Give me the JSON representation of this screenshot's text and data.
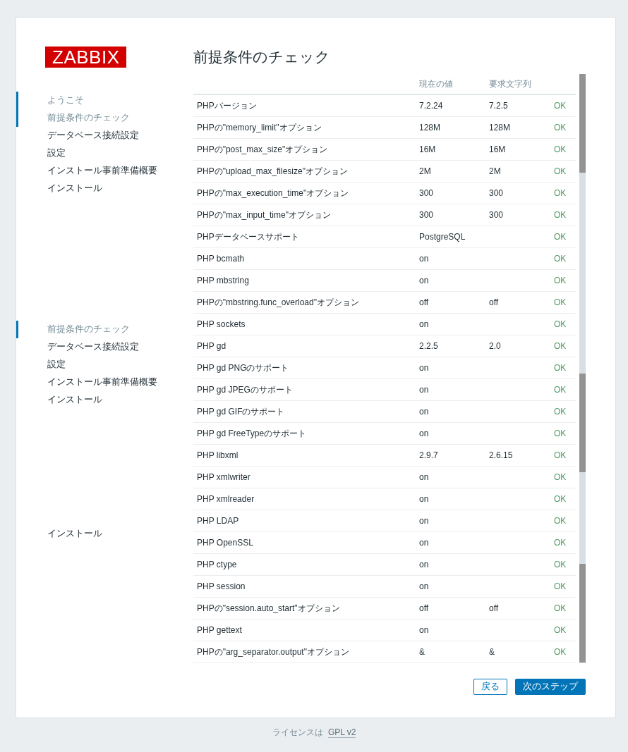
{
  "sidebar": {
    "logo": "ZABBIX",
    "groups": [
      {
        "items": [
          {
            "label": "ようこそ",
            "completed": true
          },
          {
            "label": "前提条件のチェック",
            "completed": true
          },
          {
            "label": "データベース接続設定",
            "completed": false
          },
          {
            "label": "設定",
            "completed": false
          },
          {
            "label": "インストール事前準備概要",
            "completed": false
          },
          {
            "label": "インストール",
            "completed": false
          }
        ]
      },
      {
        "items": [
          {
            "label": "前提条件のチェック",
            "completed": true
          },
          {
            "label": "データベース接続設定",
            "completed": false
          },
          {
            "label": "設定",
            "completed": false
          },
          {
            "label": "インストール事前準備概要",
            "completed": false
          },
          {
            "label": "インストール",
            "completed": false
          }
        ]
      },
      {
        "items": [
          {
            "label": "インストール",
            "completed": false
          }
        ]
      }
    ]
  },
  "title": "前提条件のチェック",
  "table": {
    "columns": [
      "現在の値",
      "要求文字列"
    ],
    "rows": [
      {
        "name": "PHPバージョン",
        "current": "7.2.24",
        "required": "7.2.5",
        "result": "OK",
        "passed": true
      },
      {
        "name": "PHPの\"memory_limit\"オプション",
        "current": "128M",
        "required": "128M",
        "result": "OK",
        "passed": true
      },
      {
        "name": "PHPの\"post_max_size\"オプション",
        "current": "16M",
        "required": "16M",
        "result": "OK",
        "passed": true
      },
      {
        "name": "PHPの\"upload_max_filesize\"オプション",
        "current": "2M",
        "required": "2M",
        "result": "OK",
        "passed": true
      },
      {
        "name": "PHPの\"max_execution_time\"オプション",
        "current": "300",
        "required": "300",
        "result": "OK",
        "passed": true
      },
      {
        "name": "PHPの\"max_input_time\"オプション",
        "current": "300",
        "required": "300",
        "result": "OK",
        "passed": true
      },
      {
        "name": "PHPデータベースサポート",
        "current": "PostgreSQL",
        "result": "OK",
        "passed": true
      },
      {
        "name": "PHP bcmath",
        "current": "on",
        "result": "OK",
        "passed": true
      },
      {
        "name": "PHP mbstring",
        "current": "on",
        "result": "OK",
        "passed": true
      },
      {
        "name": "PHPの\"mbstring.func_overload\"オプション",
        "current": "off",
        "required": "off",
        "result": "OK",
        "passed": true
      },
      {
        "name": "PHP sockets",
        "current": "on",
        "result": "OK",
        "passed": true
      },
      {
        "name": "PHP gd",
        "current": "2.2.5",
        "required": "2.0",
        "result": "OK",
        "passed": true
      },
      {
        "name": "PHP gd PNGのサポート",
        "current": "on",
        "result": "OK",
        "passed": true
      },
      {
        "name": "PHP gd JPEGのサポート",
        "current": "on",
        "result": "OK",
        "passed": true
      },
      {
        "name": "PHP gd GIFのサポート",
        "current": "on",
        "result": "OK",
        "passed": true
      },
      {
        "name": "PHP gd FreeTypeのサポート",
        "current": "on",
        "result": "OK",
        "passed": true
      },
      {
        "name": "PHP libxml",
        "current": "2.9.7",
        "required": "2.6.15",
        "result": "OK",
        "passed": true
      },
      {
        "name": "PHP xmlwriter",
        "current": "on",
        "result": "OK",
        "passed": true
      },
      {
        "name": "PHP xmlreader",
        "current": "on",
        "result": "OK",
        "passed": true
      },
      {
        "name": "PHP LDAP",
        "current": "on",
        "result": "OK",
        "passed": true
      },
      {
        "name": "PHP OpenSSL",
        "current": "on",
        "result": "OK",
        "passed": true
      },
      {
        "name": "PHP ctype",
        "current": "on",
        "result": "OK",
        "passed": true
      },
      {
        "name": "PHP session",
        "current": "on",
        "result": "OK",
        "passed": true
      },
      {
        "name": "PHPの\"session.auto_start\"オプション",
        "current": "off",
        "required": "off",
        "result": "OK",
        "passed": true
      },
      {
        "name": "PHP gettext",
        "current": "on",
        "result": "OK",
        "passed": true
      },
      {
        "name": "PHPの\"arg_separator.output\"オプション",
        "current": "&",
        "required": "&",
        "result": "OK",
        "passed": true
      }
    ]
  },
  "buttons": [
    {
      "label": "戻る",
      "kind": "secondary"
    },
    {
      "label": "次のステップ",
      "kind": "primary"
    }
  ],
  "footer": {
    "text": "ライセンスは",
    "link": "GPL v2"
  }
}
